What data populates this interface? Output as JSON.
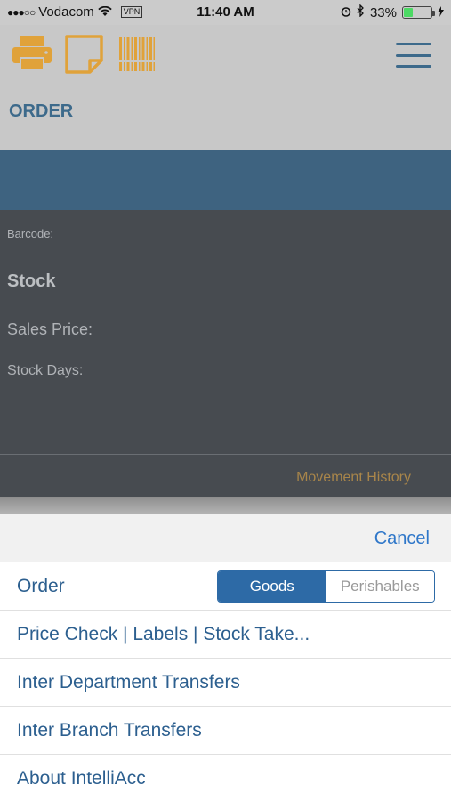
{
  "status_bar": {
    "signal": "●●●○○",
    "carrier": "Vodacom",
    "vpn": "VPN",
    "time": "11:40 AM",
    "battery_percent": "33%",
    "battery_level": 0.33
  },
  "toolbar": {
    "icons": [
      "printer-icon",
      "note-icon",
      "barcode-icon"
    ],
    "icon_color": "#e0a23a"
  },
  "page_title": "ORDER",
  "detail": {
    "barcode_label": "Barcode:",
    "stock_label": "Stock",
    "sales_price_label": "Sales Price:",
    "stock_days_label": "Stock Days:",
    "movement_history": "Movement History"
  },
  "action_sheet": {
    "cancel": "Cancel",
    "items": [
      {
        "label": "Order"
      },
      {
        "label": "Price Check | Labels | Stock Take..."
      },
      {
        "label": "Inter Department Transfers"
      },
      {
        "label": "Inter Branch Transfers"
      },
      {
        "label": "About IntelliAcc"
      }
    ],
    "order_toggle": {
      "options": [
        "Goods",
        "Perishables"
      ],
      "selected": "Goods"
    }
  },
  "colors": {
    "accent_blue": "#2d6aa6",
    "header_blue": "#3d6a8b",
    "orange": "#e0a23a"
  }
}
